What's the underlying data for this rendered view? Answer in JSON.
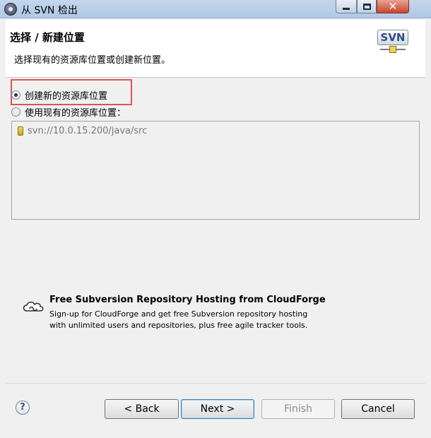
{
  "window": {
    "title": "从 SVN 检出",
    "close_glyph": "✕"
  },
  "header": {
    "title": "选择 / 新建位置",
    "description": "选择现有的资源库位置或创建新位置。",
    "logo_text": "SVN"
  },
  "options": {
    "create_new_label": "创建新的资源库位置",
    "create_new_selected": true,
    "use_existing_label": "使用现有的资源库位置：",
    "use_existing_selected": false
  },
  "repositories": [
    {
      "url": "svn://10.0.15.200/java/src"
    }
  ],
  "promo": {
    "title": "Free Subversion Repository Hosting from CloudForge",
    "line1": "Sign-up for CloudForge and get free Subversion repository hosting",
    "line2": "with unlimited users and repositories, plus free agile tracker tools."
  },
  "footer": {
    "help_glyph": "?",
    "back_label": "< Back",
    "next_label": "Next >",
    "finish_label": "Finish",
    "cancel_label": "Cancel"
  },
  "colors": {
    "highlight": "#e05252",
    "svn_text": "#2c4d88"
  },
  "icons": {
    "title": "svn-checkout-icon",
    "repo": "repository-location-icon",
    "promo": "cloudforge-icon",
    "help": "help-icon"
  }
}
